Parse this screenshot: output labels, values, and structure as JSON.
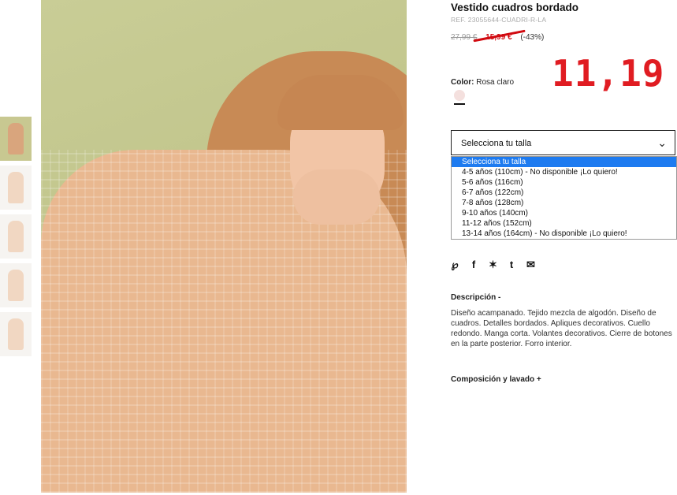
{
  "product": {
    "title": "Vestido cuadros bordado",
    "ref": "REF. 23055644-CUADRI-R-LA",
    "old_price": "27,99 €",
    "new_price": "15,99 €",
    "discount": "(-43%)",
    "handwritten_price": "11,19"
  },
  "color": {
    "label": "Color:",
    "value": "Rosa claro",
    "swatch_color": "#f4e0de"
  },
  "size": {
    "select_label": "Selecciona tu talla",
    "options": [
      "Selecciona tu talla",
      "4-5 años (110cm) - No disponible ¡Lo quiero!",
      "5-6 años (116cm)",
      "6-7 años (122cm)",
      "7-8 años (128cm)",
      "9-10 años (140cm)",
      "11-12 años (152cm)",
      "13-14 años (164cm) - No disponible ¡Lo quiero!"
    ],
    "selected_index": 0
  },
  "share_icons": [
    "pinterest-icon",
    "facebook-icon",
    "twitter-icon",
    "tumblr-icon",
    "email-icon"
  ],
  "description": {
    "title": "Descripción -",
    "text": "Diseño acampanado. Tejido mezcla de algodón. Diseño de cuadros. Detalles bordados. Apliques decorativos. Cuello redondo. Manga corta. Volantes decorativos. Cierre de botones en la parte posterior. Forro interior."
  },
  "composition": {
    "title": "Composición y lavado +"
  },
  "colors": {
    "accent_red": "#d10a10",
    "selected_option": "#1e7bf0"
  }
}
